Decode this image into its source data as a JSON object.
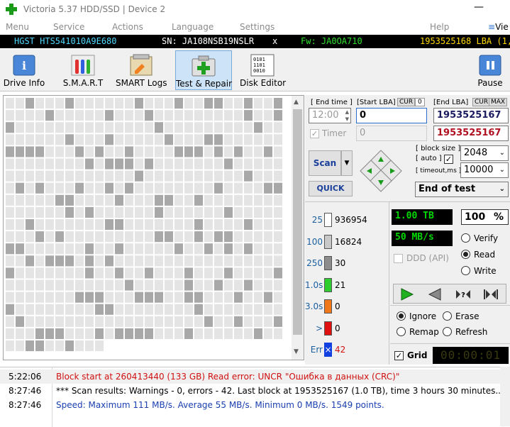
{
  "window": {
    "title": "Victoria 5.37 HDD/SSD | Device 2"
  },
  "menu": {
    "items": [
      "Menu",
      "Service",
      "Actions",
      "Language",
      "Settings",
      "Help"
    ],
    "right_label": "Vie"
  },
  "info": {
    "model": "HGST HTS541010A9E680",
    "serial": "SN: JA108NSB19NSLR",
    "close": "x",
    "firmware": "Fw: JA0OA710",
    "lba": "1953525168 LBA (1,0"
  },
  "toolbar": {
    "drive_info": "Drive Info",
    "smart": "S.M.A.R.T",
    "smart_logs": "SMART Logs",
    "test_repair": "Test & Repair",
    "disk_editor": "Disk Editor",
    "pause": "Pause"
  },
  "scan": {
    "end_time_label": "[ End time ]",
    "start_lba_label": "[Start LBA]",
    "cur_label": "CUR",
    "start_cur_value": "0",
    "end_lba_label": "[End LBA]",
    "max_label": "MAX",
    "end_time_value": "12:00",
    "start_lba_value": "0",
    "end_lba_value": "1953525167",
    "timer_label": "Timer",
    "timer_value": "0",
    "end_lba_current": "1953525167",
    "scan_button": "Scan",
    "quick_button": "QUICK",
    "block_size_label": "[ block size ]",
    "auto_label": "[ auto ]",
    "timeout_label": "[ timeout,ms ]",
    "block_size_value": "2048",
    "timeout_value": "10000",
    "end_action": "End of test"
  },
  "stats": {
    "legend": [
      {
        "label": "25",
        "count": "936954",
        "color": "#ffffff",
        "label_color": "#1a5fa0"
      },
      {
        "label": "100",
        "count": "16824",
        "color": "#c8c8c8",
        "label_color": "#1a5fa0"
      },
      {
        "label": "250",
        "count": "30",
        "color": "#8c8c8c",
        "label_color": "#1a5fa0"
      },
      {
        "label": "1.0s",
        "count": "21",
        "color": "#2ecc2e",
        "label_color": "#1a5fa0"
      },
      {
        "label": "3.0s",
        "count": "0",
        "color": "#f07818",
        "label_color": "#1a5fa0"
      },
      {
        "label": ">",
        "count": "0",
        "color": "#e01010",
        "label_color": "#1a5fa0"
      },
      {
        "label": "Err",
        "count": "42",
        "color": "#1040e0",
        "label_color": "#1a5fa0"
      }
    ],
    "size": "1.00 TB",
    "percent": "100",
    "percent_sign": "%",
    "speed": "50 MB/s",
    "ddd_label": "DDD (API)",
    "verify": "Verify",
    "read": "Read",
    "write": "Write",
    "ignore": "Ignore",
    "erase": "Erase",
    "remap": "Remap",
    "refresh": "Refresh",
    "grid_label": "Grid",
    "grid_timer": "00:00:01"
  },
  "log": [
    {
      "time": "5:22:06",
      "text": "Block start at 260413440 (133 GB) Read error: UNCR \"Ошибка в данных (CRC)\"",
      "color": "#d01010"
    },
    {
      "time": "8:27:46",
      "text": "*** Scan results: Warnings - 0, errors - 42. Last block at 1953525167 (1.0 TB), time 3 hours 30 minutes...",
      "color": "#000000"
    },
    {
      "time": "8:27:46",
      "text": "Speed: Maximum 111 MB/s. Average 55 MB/s. Minimum 0 MB/s. 1549 points.",
      "color": "#1a3fb0"
    }
  ]
}
